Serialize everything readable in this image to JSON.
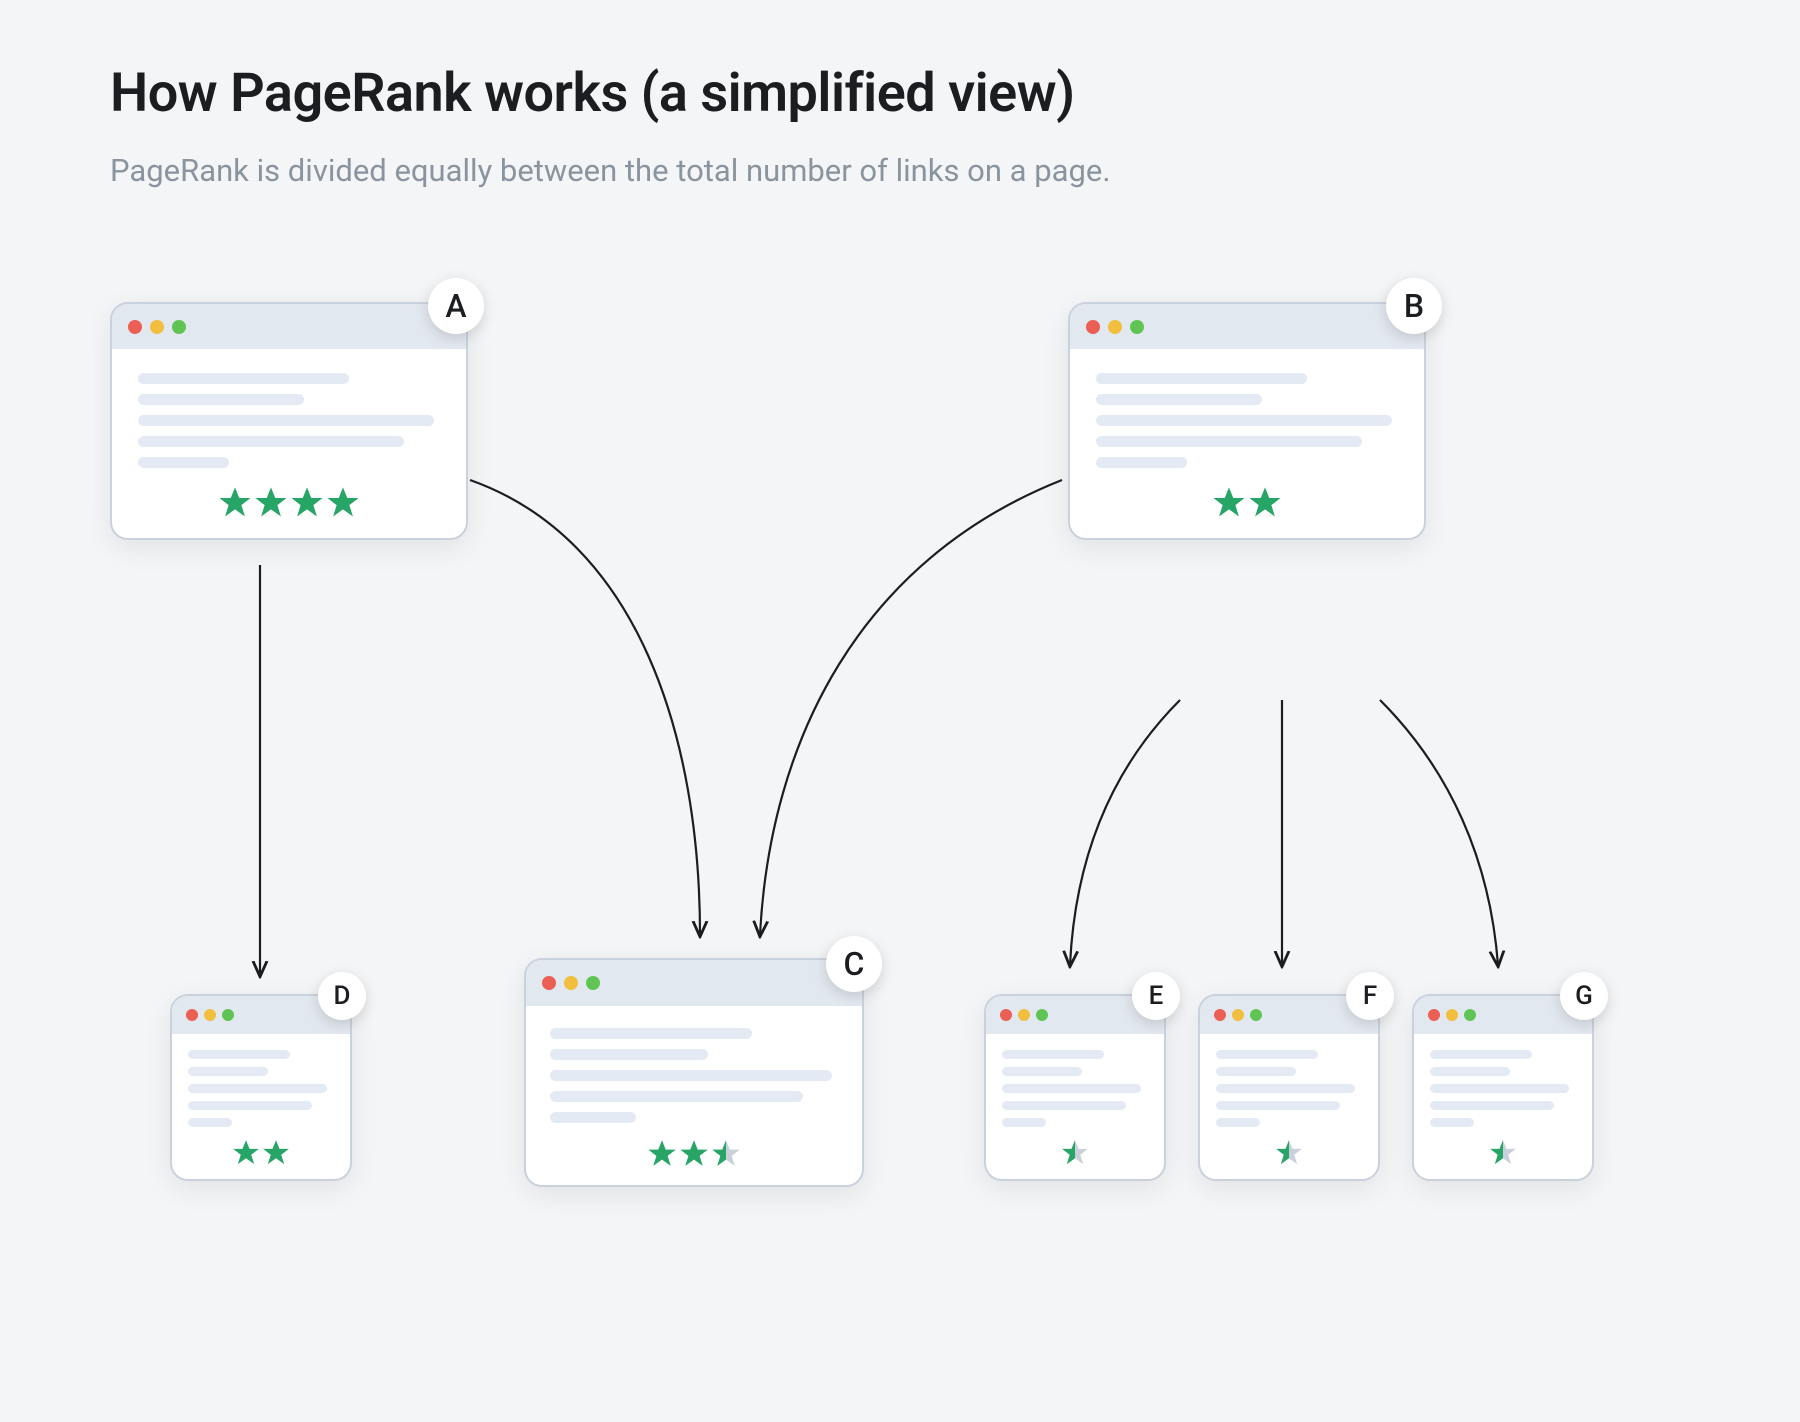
{
  "title": "How PageRank works (a simplified view)",
  "subtitle": "PageRank is divided equally between the total number of links on a page.",
  "colors": {
    "star_fill": "#27a567",
    "star_empty": "#c8d0d9",
    "arrow": "#1b1d20"
  },
  "nodes": {
    "A": {
      "label": "A",
      "stars": 4.0
    },
    "B": {
      "label": "B",
      "stars": 2.0
    },
    "C": {
      "label": "C",
      "stars": 2.5
    },
    "D": {
      "label": "D",
      "stars": 2.0
    },
    "E": {
      "label": "E",
      "stars": 0.5
    },
    "F": {
      "label": "F",
      "stars": 0.5
    },
    "G": {
      "label": "G",
      "stars": 0.5
    }
  },
  "edges": [
    {
      "from": "A",
      "to": "D"
    },
    {
      "from": "A",
      "to": "C"
    },
    {
      "from": "B",
      "to": "C"
    },
    {
      "from": "B",
      "to": "E"
    },
    {
      "from": "B",
      "to": "F"
    },
    {
      "from": "B",
      "to": "G"
    }
  ]
}
